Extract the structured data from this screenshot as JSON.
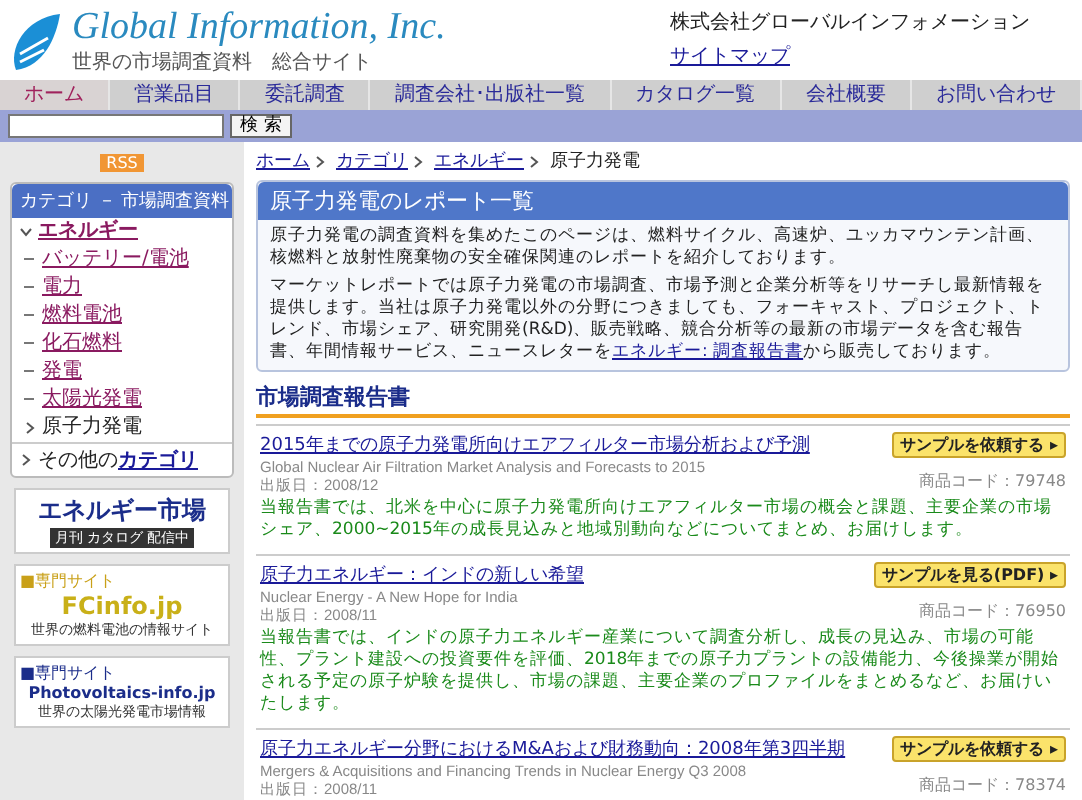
{
  "header": {
    "logo_title": "Global Information, Inc.",
    "logo_subtitle": "世界の市場調査資料　総合サイト",
    "company": "株式会社グローバルインフォメーション",
    "sitemap": "サイトマップ"
  },
  "nav": [
    {
      "label": "ホーム",
      "selected": true
    },
    {
      "label": "営業品目",
      "selected": false
    },
    {
      "label": "委託調査",
      "selected": false
    },
    {
      "label": "調査会社･出版社一覧",
      "selected": false
    },
    {
      "label": "カタログ一覧",
      "selected": false
    },
    {
      "label": "会社概要",
      "selected": false
    },
    {
      "label": "お問い合わせ",
      "selected": false
    }
  ],
  "search": {
    "button": "検 索"
  },
  "sidebar": {
    "rss": "RSS",
    "category_title": "カテゴリ － 市場調査資料",
    "categories": [
      {
        "label": "エネルギー",
        "expanded": true,
        "children": [
          {
            "label": "バッテリー/電池",
            "selected": false
          },
          {
            "label": "電力",
            "selected": false
          },
          {
            "label": "燃料電池",
            "selected": false
          },
          {
            "label": "化石燃料",
            "selected": false
          },
          {
            "label": "発電",
            "selected": false
          },
          {
            "label": "太陽光発電",
            "selected": false
          },
          {
            "label": "原子力発電",
            "selected": true
          }
        ]
      }
    ],
    "other_prefix": "その他の",
    "other_link": "カテゴリ",
    "banners": [
      {
        "kind": "energy",
        "title": "エネルギー市場",
        "subtitle": "月刊 カタログ 配信中"
      },
      {
        "kind": "fc",
        "tag": "■専門サイト",
        "title": "FCinfo.jp",
        "subtitle": "世界の燃料電池の情報サイト"
      },
      {
        "kind": "pv",
        "tag": "■専門サイト",
        "title": "Photovoltaics-info.jp",
        "subtitle": "世界の太陽光発電市場情報"
      }
    ]
  },
  "breadcrumb": [
    {
      "label": "ホーム",
      "link": true
    },
    {
      "label": "カテゴリ",
      "link": true
    },
    {
      "label": "エネルギー",
      "link": true
    },
    {
      "label": "原子力発電",
      "link": false
    }
  ],
  "intro": {
    "title": "原子力発電のレポート一覧",
    "paragraph_1": "原子力発電の調査資料を集めたこのページは、燃料サイクル、高速炉、ユッカマウンテン計画、核燃料と放射性廃棄物の安全確保関連のレポートを紹介しております。",
    "paragraph_2_before": "マーケットレポートでは原子力発電の市場調査、市場予測と企業分析等をリサーチし最新情報を提供します。当社は原子力発電以外の分野につきましても、フォーキャスト、プロジェクト、トレンド、市場シェア、研究開発(R&D)、販売戦略、競合分析等の最新の市場データを含む報告書、年間情報サービス、ニュースレターを",
    "paragraph_2_link": "エネルギー: 調査報告書",
    "paragraph_2_after": "から販売しております。"
  },
  "section_title": "市場調査報告書",
  "reports": [
    {
      "title": "2015年までの原子力発電所向けエアフィルター市場分析および予測",
      "english": "Global Nuclear Air Filtration Market Analysis and Forecasts to 2015",
      "date": "出版日：2008/12",
      "code": "商品コード：79748",
      "button": "サンプルを依頼する ▸",
      "description": "当報告書では、北米を中心に原子力発電所向けエアフィルター市場の概会と課題、主要企業の市場シェア、2000~2015年の成長見込みと地域別動向などについてまとめ、お届けします。"
    },
    {
      "title": "原子力エネルギー：インドの新しい希望",
      "english": "Nuclear Energy - A New Hope for India",
      "date": "出版日：2008/11",
      "code": "商品コード：76950",
      "button": "サンプルを見る(PDF) ▸",
      "description": "当報告書では、インドの原子力エネルギー産業について調査分析し、成長の見込み、市場の可能性、プラント建設への投資要件を評価、2018年までの原子力プラントの設備能力、今後操業が開始される予定の原子炉験を提供し、市場の課題、主要企業のプロファイルをまとめるなど、お届けいたします。"
    },
    {
      "title": "原子力エネルギー分野におけるM&Aおよび財務動向：2008年第3四半期",
      "english": "Mergers & Acquisitions and Financing Trends in Nuclear Energy Q3 2008",
      "date": "出版日：2008/11",
      "code": "商品コード：78374",
      "button": "サンプルを依頼する ▸"
    }
  ]
}
